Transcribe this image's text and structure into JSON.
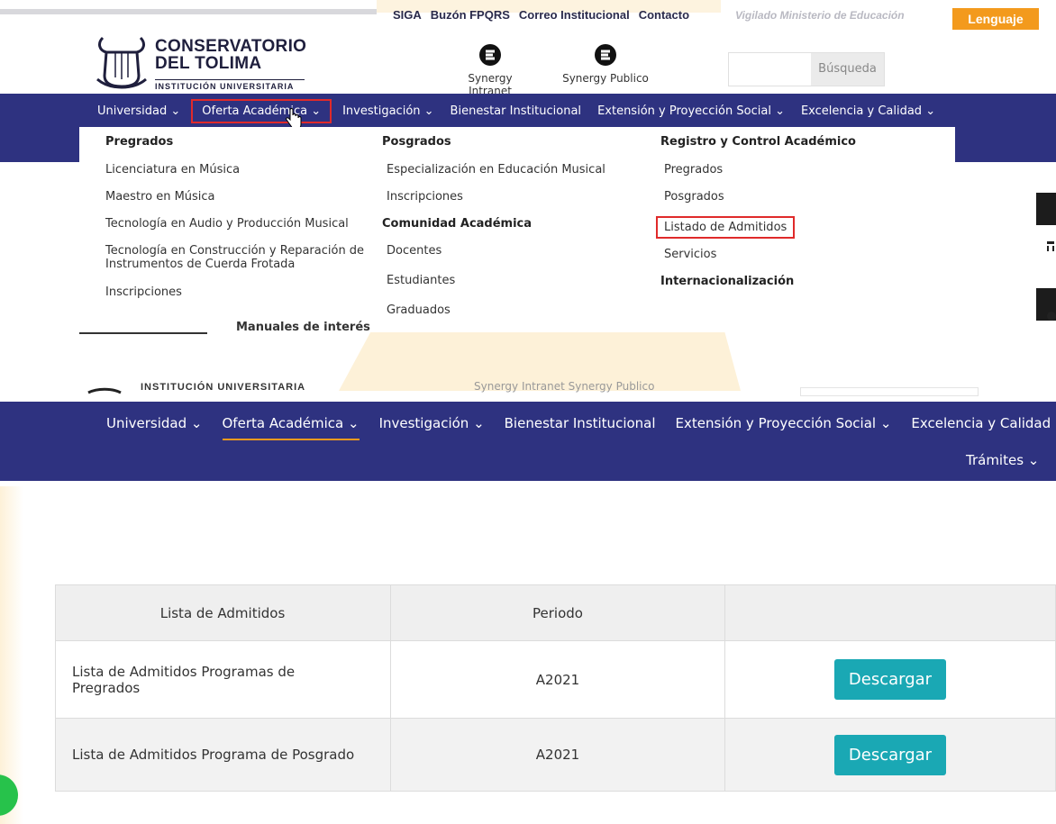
{
  "topbar": {
    "links": [
      "SIGA",
      "Buzón FPQRS",
      "Correo Institucional",
      "Contacto"
    ],
    "vigilado": "Vigilado Ministerio de Educación",
    "language": "Lenguaje"
  },
  "logo": {
    "line1": "CONSERVATORIO",
    "line2": "DEL TOLIMA",
    "line3": "INSTITUCIÓN UNIVERSITARIA"
  },
  "synergy": {
    "intranet": "Synergy Intranet",
    "publico": "Synergy Publico"
  },
  "search": {
    "button": "Búsqueda"
  },
  "nav": {
    "items": [
      "Universidad",
      "Oferta Académica",
      "Investigación",
      "Bienestar Institucional",
      "Extensión y Proyección Social",
      "Excelencia y Calidad"
    ],
    "tramites": "Trámites"
  },
  "mega": {
    "col1": {
      "heading": "Pregrados",
      "items": [
        "Licenciatura en Música",
        "Maestro en Música",
        "Tecnología en Audio y Producción Musical",
        "Tecnología en Construcción y Reparación de",
        "Instrumentos de Cuerda Frotada",
        "Inscripciones"
      ]
    },
    "col2": {
      "heading": "Posgrados",
      "items": [
        "Especialización en Educación Musical",
        "Inscripciones"
      ],
      "heading2": "Comunidad Académica",
      "items2": [
        "Docentes",
        "Estudiantes",
        "Graduados"
      ]
    },
    "col3": {
      "heading": "Registro y Control Académico",
      "items": [
        "Pregrados",
        "Posgrados",
        "Listado de Admitidos",
        "Servicios"
      ],
      "heading2": "Internacionalización"
    }
  },
  "behind": {
    "manuales": "Manuales de interés",
    "institucion": "INSTITUCIÓN UNIVERSITARIA",
    "synergy": "Synergy Intranet      Synergy Publico"
  },
  "table": {
    "headers": [
      "Lista de Admitidos",
      "Periodo",
      ""
    ],
    "rows": [
      {
        "name_l1": "Lista de Admitidos Programas de",
        "name_l2": "Pregrados",
        "period": "A2021",
        "action": "Descargar"
      },
      {
        "name_l1": "Lista de Admitidos Programa de Posgrado",
        "name_l2": "",
        "period": "A2021",
        "action": "Descargar"
      }
    ]
  },
  "colors": {
    "nav": "#2e3280",
    "accent": "#f39a1d",
    "button": "#1aa8b4",
    "highlight": "#e02a2a"
  }
}
